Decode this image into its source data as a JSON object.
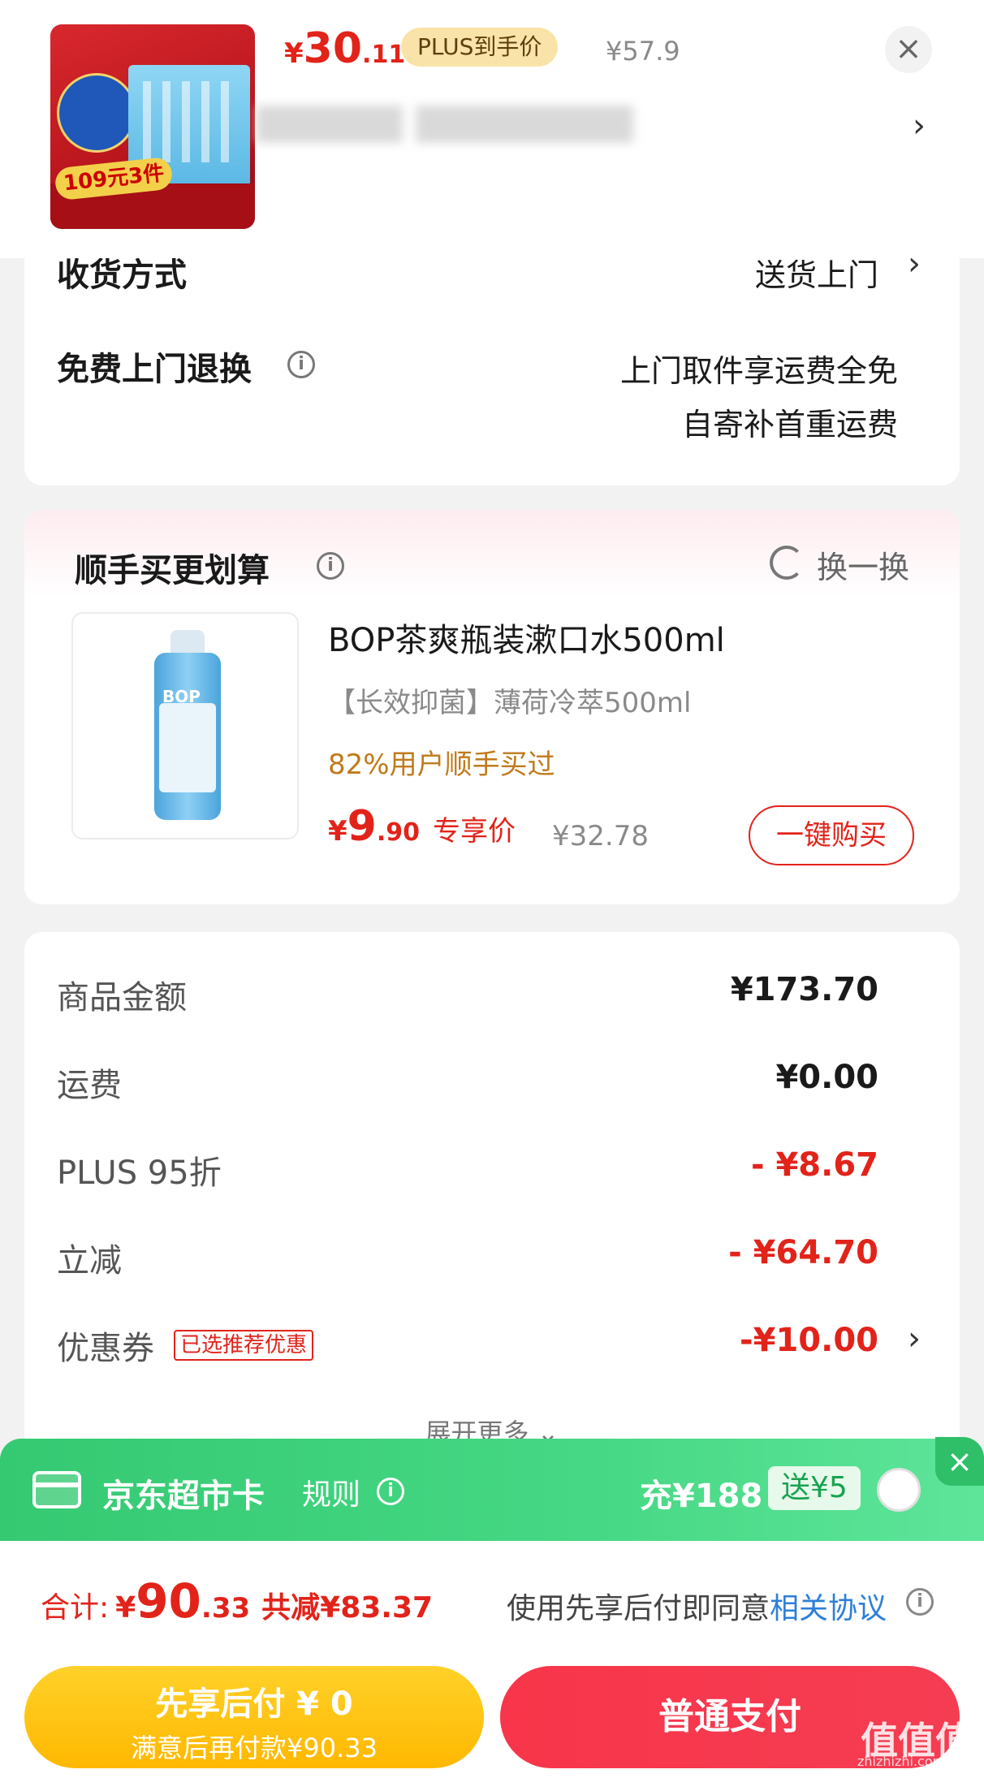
{
  "header": {
    "price_yen": "¥",
    "price_int": "30",
    "price_dec": ".11",
    "plus_badge": "PLUS到手价",
    "original_price": "¥57.9",
    "close": "×",
    "chevron": "›",
    "thumb_promo": "109元3件"
  },
  "delivery": {
    "method_label": "收货方式",
    "method_value": "送货上门",
    "chevron": "›",
    "return_label": "免费上门退换",
    "return_value_line1": "上门取件享运费全免",
    "return_value_line2": "自寄补首重运费"
  },
  "addon": {
    "title": "顺手买更划算",
    "swap_label": "换一换",
    "product_name": "BOP茶爽瓶装漱口水500ml",
    "product_sub": "【长效抑菌】薄荷冷萃500ml",
    "social_proof": "82%用户顺手买过",
    "price_yen": "¥",
    "price_int": "9",
    "price_dec": ".90",
    "price_tag": "专享价",
    "original_price": "¥32.78",
    "buy_button": "一键购买",
    "bottle_brand": "BOP"
  },
  "summary": {
    "rows": [
      {
        "label": "商品金额",
        "value": "¥173.70"
      },
      {
        "label": "运费",
        "value": "¥0.00"
      },
      {
        "label": "PLUS 95折",
        "value": "- ¥8.67"
      },
      {
        "label": "立减",
        "value": "- ¥64.70"
      },
      {
        "label": "优惠券",
        "value": "-¥10.00"
      }
    ],
    "coupon_tag": "已选推荐优惠",
    "expand_label": "展开更多 ⌄"
  },
  "jd_card": {
    "title": "京东超市卡",
    "rule": "规则",
    "charge": "充¥188",
    "gift": "送¥5",
    "close": "×"
  },
  "total": {
    "label": "合计:",
    "yen": "¥",
    "int": "90",
    "dec": ".33",
    "reduced": "共减¥83.37",
    "agree_prefix": "使用先享后付即同意",
    "agree_link": "相关协议"
  },
  "buttons": {
    "later_line1": "先享后付 ¥ 0",
    "later_line2": "满意后再付款¥90.33",
    "pay": "普通支付"
  },
  "watermark": {
    "main": "值值值",
    "sub": "zhizhizhi.com"
  },
  "colors": {
    "accent_red": "#e2231a",
    "jd_green": "#35c972",
    "link_blue": "#2d7fd9",
    "later_yellow": "#ffb800"
  }
}
